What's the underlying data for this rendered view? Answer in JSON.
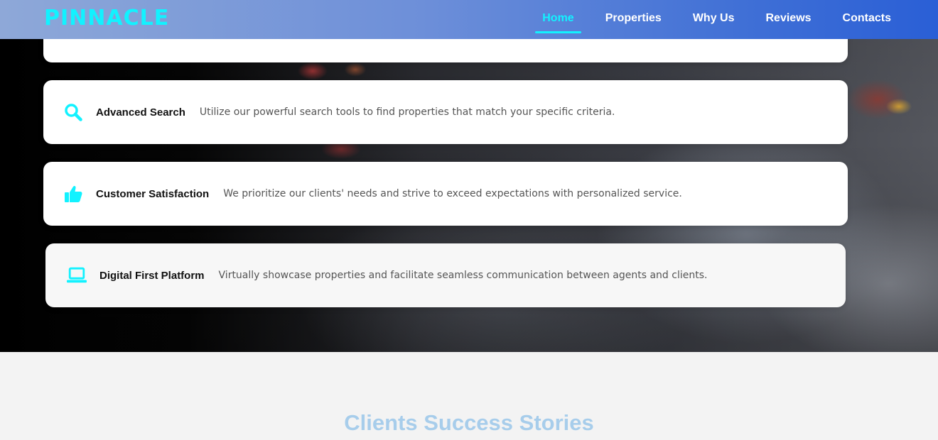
{
  "brand": {
    "logo": "PINNACLE"
  },
  "nav": {
    "items": [
      {
        "label": "Home",
        "active": true
      },
      {
        "label": "Properties",
        "active": false
      },
      {
        "label": "Why Us",
        "active": false
      },
      {
        "label": "Reviews",
        "active": false
      },
      {
        "label": "Contacts",
        "active": false
      }
    ]
  },
  "features": [
    {
      "icon": "search-icon",
      "title": "Advanced Search",
      "description": "Utilize our powerful search tools to find properties that match your specific criteria."
    },
    {
      "icon": "thumbs-up-icon",
      "title": "Customer Satisfaction",
      "description": "We prioritize our clients' needs and strive to exceed expectations with personalized service."
    },
    {
      "icon": "laptop-icon",
      "title": "Digital First Platform",
      "description": "Virtually showcase properties and facilitate seamless communication between agents and clients."
    }
  ],
  "testimonials": {
    "heading": "Clients Success Stories"
  },
  "colors": {
    "accent": "#12f2ff",
    "nav_gradient_start": "#8ea8d8",
    "nav_gradient_end": "#2a5fd6",
    "heading": "#a7cdeb"
  }
}
